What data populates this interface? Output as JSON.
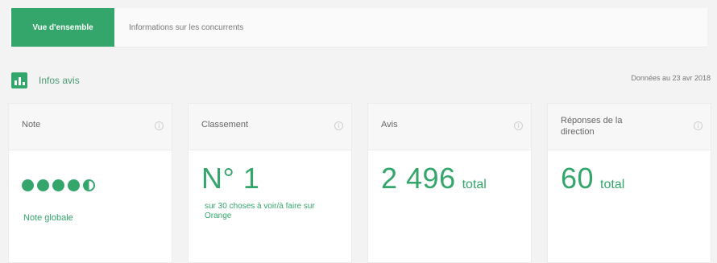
{
  "tabs": {
    "active": "Vue d'ensemble",
    "second": "Informations sur les concurrents"
  },
  "section": {
    "title": "Infos avis",
    "updated": "Données au 23 avr 2018"
  },
  "cards": {
    "note": {
      "title": "Note",
      "rating_value": 4.5,
      "rating_max": 5,
      "label": "Note globale"
    },
    "classement": {
      "title": "Classement",
      "value": "N° 1",
      "subtitle": "sur 30 choses à voir/à faire sur Orange"
    },
    "avis": {
      "title": "Avis",
      "value": "2 496",
      "unit": "total"
    },
    "reponses": {
      "title": "Réponses de la direction",
      "value": "60",
      "unit": "total"
    }
  },
  "colors": {
    "accent": "#34a66b"
  }
}
